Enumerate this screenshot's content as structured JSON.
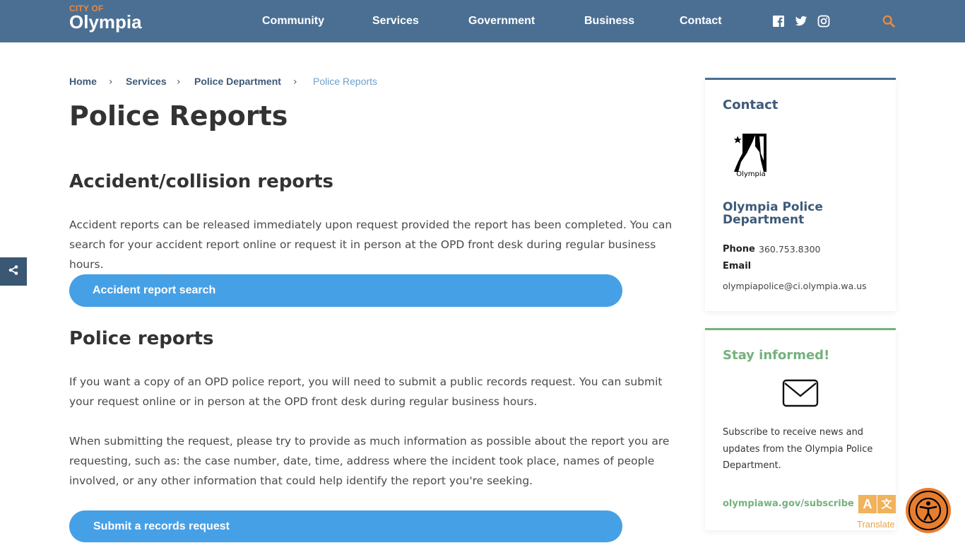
{
  "header": {
    "logo_small": "CITY OF",
    "logo_big": "Olympia",
    "nav": [
      "Community",
      "Services",
      "Government",
      "Business",
      "Contact"
    ],
    "social_icons": [
      "facebook-icon",
      "twitter-icon",
      "instagram-icon"
    ],
    "search_icon": "search-icon"
  },
  "breadcrumb": {
    "items": [
      "Home",
      "Services",
      "Police Department"
    ],
    "current": "Police Reports",
    "separator": "›"
  },
  "main": {
    "title": "Police Reports",
    "section1": {
      "heading": "Accident/collision reports",
      "paragraph": "Accident reports can be released immediately upon request provided the report has been completed. You can search for your accident report online or request it in person at the OPD front desk during regular business hours.",
      "button": "Accident report search"
    },
    "section2": {
      "heading": "Police reports",
      "paragraph1": "If you want a copy of an OPD police report, you will need to submit a public records request. You can submit your request online or in person at the OPD front desk during regular business hours.",
      "paragraph2": "When submitting the request, please try to provide as much information as possible about the report you are requesting, such as: the case number, date, time, address where the incident took place, names of people involved, or any other information that could help identify the report you're seeking.",
      "button": "Submit a records request"
    }
  },
  "sidebar": {
    "contact": {
      "title": "Contact",
      "logo_text": "Olympia",
      "department": "Olympia Police Department",
      "phone_label": "Phone",
      "phone": "360.753.8300",
      "email_label": "Email",
      "email": "olympiapolice@ci.olympia.wa.us"
    },
    "stay": {
      "title": "Stay informed!",
      "text": "Subscribe to receive news and updates from the Olympia Police Department.",
      "link": "olympiawa.gov/subscribe"
    }
  },
  "widgets": {
    "translate_label": "Translate",
    "translate_glyph_a": "A",
    "translate_glyph_b": "文"
  },
  "colors": {
    "header_bg": "#4a6f93",
    "accent_orange": "#e8893f",
    "button_blue": "#46a0e6",
    "green": "#74b27c",
    "link_blue": "#3d5a78"
  }
}
